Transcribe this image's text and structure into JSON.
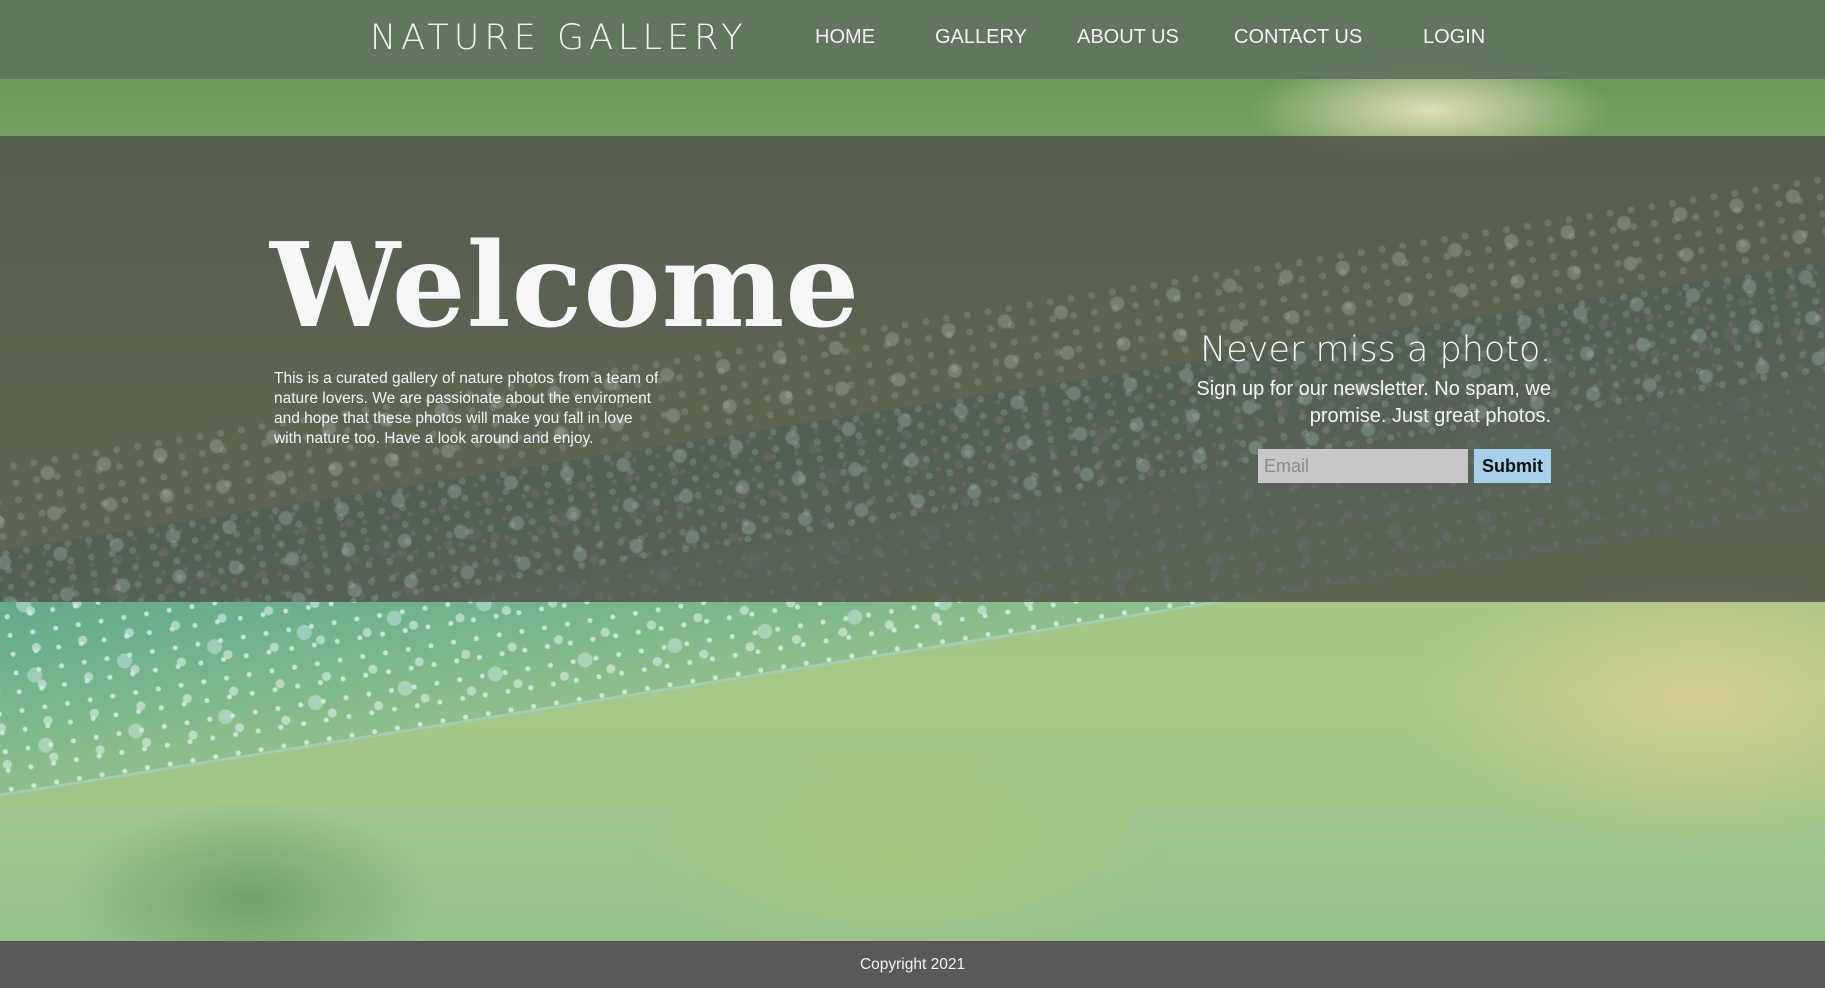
{
  "brand": "NATURE GALLERY",
  "nav": {
    "home": "HOME",
    "gallery": "GALLERY",
    "about": "ABOUT US",
    "contact": "CONTACT US",
    "login": "LOGIN"
  },
  "hero": {
    "title": "Welcome",
    "intro": "This is a curated gallery of nature photos from a team of nature lovers. We are passionate about the enviroment and hope that these photos will make you fall in love with nature too. Have a look around and enjoy."
  },
  "newsletter": {
    "title": "Never miss a photo.",
    "text": "Sign up for our newsletter. No spam, we promise. Just great photos.",
    "email_placeholder": "Email",
    "email_value": "",
    "submit_label": "Submit"
  },
  "footer": {
    "copyright": "Copyright 2021"
  },
  "colors": {
    "navbar": "#627460",
    "hero_overlay": "#50524a",
    "submit_button": "#a7cfea",
    "email_field": "#c7c7c7",
    "footer": "#595959"
  }
}
